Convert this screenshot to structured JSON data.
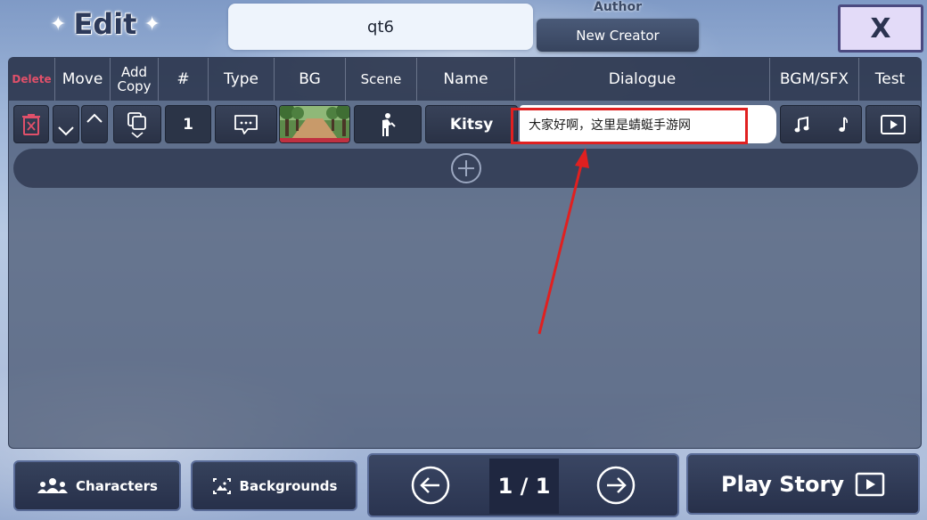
{
  "header": {
    "title": "Edit",
    "sparkle_left": "✦",
    "sparkle_right": "✦",
    "story_name": "qt6",
    "author_label": "Author",
    "author_value": "New Creator",
    "close_label": "X"
  },
  "table": {
    "columns": {
      "delete": "Delete",
      "move": "Move",
      "add_copy_line1": "Add",
      "add_copy_line2": "Copy",
      "number": "#",
      "type": "Type",
      "bg": "BG",
      "scene": "Scene",
      "name": "Name",
      "dialogue": "Dialogue",
      "bgm_sfx": "BGM/SFX",
      "test": "Test"
    },
    "rows": [
      {
        "number": "1",
        "type_icon": "dialogue-bubble-icon",
        "bg_icon": "forest-path-thumbnail",
        "scene_icon": "standing-person-icon",
        "name": "Kitsy",
        "dialogue": "大家好啊，这里是蜻蜓手游网",
        "bgm_icon": "music-note-icon",
        "sfx_icon": "single-note-icon"
      }
    ],
    "add_row_icon": "plus-circle-icon"
  },
  "bottom": {
    "characters_label": "Characters",
    "backgrounds_label": "Backgrounds",
    "page_indicator": "1 / 1",
    "play_story_label": "Play Story"
  },
  "colors": {
    "delete_red": "#e0506a",
    "highlight_red": "#e02020",
    "panel_dark": "#2b3447"
  }
}
